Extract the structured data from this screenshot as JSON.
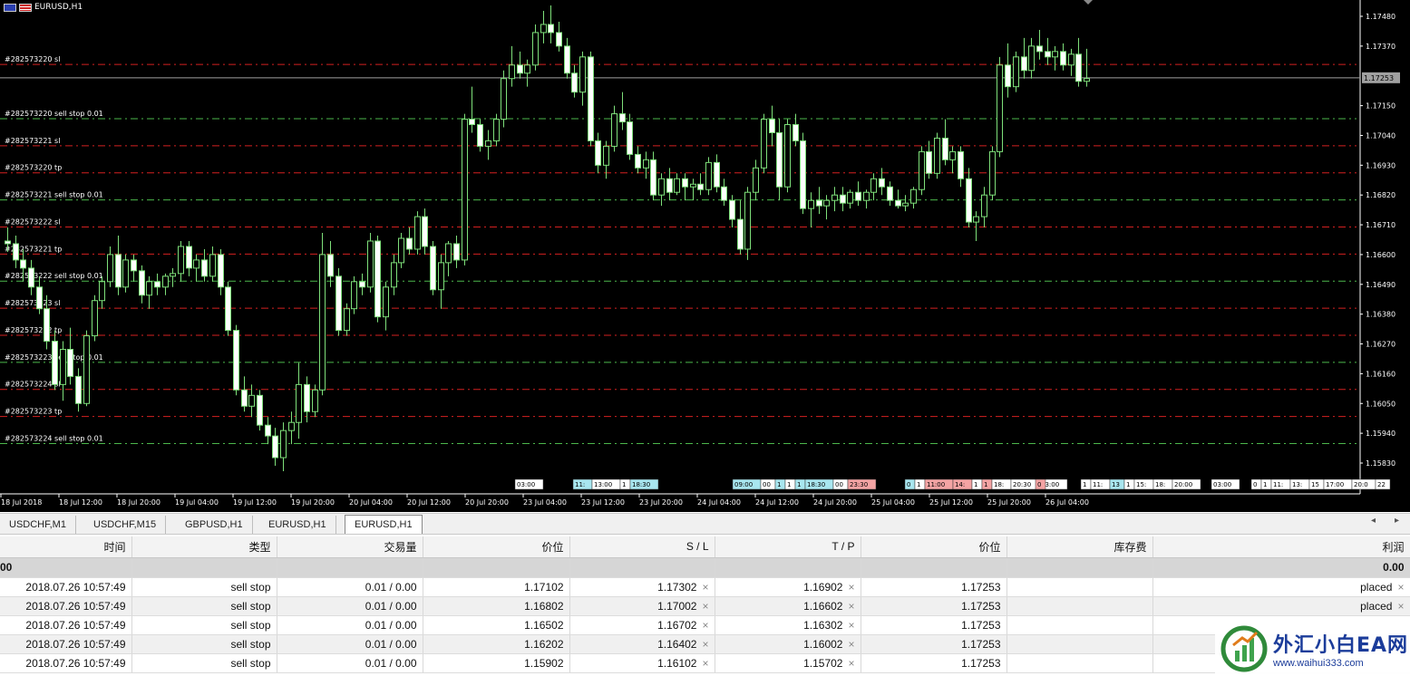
{
  "chart": {
    "symbol": "EURUSD,H1",
    "price_levels": [
      "1.17480",
      "1.17370",
      "1.17253",
      "1.17150",
      "1.17040",
      "1.16930",
      "1.16820",
      "1.16710",
      "1.16600",
      "1.16490",
      "1.16380",
      "1.16270",
      "1.16160",
      "1.16050",
      "1.15940",
      "1.15830"
    ],
    "current_price": "1.17253",
    "order_lines": [
      {
        "label": "#282573220 sl",
        "type": "sl"
      },
      {
        "label": "#282573220 sell stop 0.01",
        "type": "entry"
      },
      {
        "label": "#282573221 sl",
        "type": "sl"
      },
      {
        "label": "#282573220 tp",
        "type": "tp"
      },
      {
        "label": "#282573221 sell stop 0.01",
        "type": "entry"
      },
      {
        "label": "#282573222 sl",
        "type": "sl"
      },
      {
        "label": "#282573221 tp",
        "type": "tp"
      },
      {
        "label": "#282573222 sell stop 0.01",
        "type": "entry"
      },
      {
        "label": "#282573223 sl",
        "type": "sl"
      },
      {
        "label": "#282573222 tp",
        "type": "tp"
      },
      {
        "label": "#282573223 sell stop 0.01",
        "type": "entry"
      },
      {
        "label": "#282573224 sl",
        "type": "sl"
      },
      {
        "label": "#282573223 tp",
        "type": "tp"
      },
      {
        "label": "#282573224 sell stop 0.01",
        "type": "entry"
      }
    ],
    "time_labels": [
      "18 Jul 2018",
      "18 Jul 12:00",
      "18 Jul 20:00",
      "19 Jul 04:00",
      "19 Jul 12:00",
      "19 Jul 20:00",
      "20 Jul 04:00",
      "20 Jul 12:00",
      "20 Jul 20:00",
      "23 Jul 04:00",
      "23 Jul 12:00",
      "23 Jul 20:00",
      "24 Jul 04:00",
      "24 Jul 12:00",
      "24 Jul 20:00",
      "25 Jul 04:00",
      "25 Jul 12:00",
      "25 Jul 20:00",
      "26 Jul 04:00"
    ],
    "event_markers": [
      {
        "text": "03:00",
        "color": "#ffffff"
      },
      {
        "text": "11:",
        "color": "#a8e6ef"
      },
      {
        "text": "13:00",
        "color": "#ffffff"
      },
      {
        "text": "1",
        "color": "#ffffff"
      },
      {
        "text": "18:30",
        "color": "#a8e6ef"
      },
      {
        "text": "09:00",
        "color": "#a8e6ef"
      },
      {
        "text": "00",
        "color": "#ffffff"
      },
      {
        "text": "1",
        "color": "#a8e6ef"
      },
      {
        "text": "1",
        "color": "#ffffff"
      },
      {
        "text": "1",
        "color": "#a8e6ef"
      },
      {
        "text": "18:30",
        "color": "#a8e6ef"
      },
      {
        "text": "00",
        "color": "#ffffff"
      },
      {
        "text": "23:30",
        "color": "#f4a4a4"
      },
      {
        "text": "0",
        "color": "#a8e6ef"
      },
      {
        "text": "1",
        "color": "#ffffff"
      },
      {
        "text": "11:00",
        "color": "#f4a4a4"
      },
      {
        "text": "14:",
        "color": "#f4a4a4"
      },
      {
        "text": "1",
        "color": "#ffffff"
      },
      {
        "text": "1",
        "color": "#f4a4a4"
      },
      {
        "text": "18:",
        "color": "#ffffff"
      },
      {
        "text": "20:30",
        "color": "#ffffff"
      },
      {
        "text": "03:00",
        "color": "#ffffff"
      },
      {
        "text": "0",
        "color": "#f4a4a4"
      },
      {
        "text": "1",
        "color": "#ffffff"
      },
      {
        "text": "11:",
        "color": "#ffffff"
      },
      {
        "text": "13",
        "color": "#a8e6ef"
      },
      {
        "text": "1",
        "color": "#ffffff"
      },
      {
        "text": "15:",
        "color": "#ffffff"
      },
      {
        "text": "18:",
        "color": "#ffffff"
      },
      {
        "text": "20:00",
        "color": "#ffffff"
      },
      {
        "text": "03:00",
        "color": "#ffffff"
      },
      {
        "text": "0",
        "color": "#ffffff"
      },
      {
        "text": "1",
        "color": "#ffffff"
      },
      {
        "text": "11:",
        "color": "#ffffff"
      },
      {
        "text": "13:",
        "color": "#ffffff"
      },
      {
        "text": "15",
        "color": "#ffffff"
      },
      {
        "text": "17:00",
        "color": "#ffffff"
      },
      {
        "text": "20:0",
        "color": "#ffffff"
      },
      {
        "text": "22",
        "color": "#ffffff"
      }
    ],
    "candles": [
      [
        1.1665,
        1.167,
        1.1661,
        1.1664
      ],
      [
        1.1664,
        1.1667,
        1.1655,
        1.1658
      ],
      [
        1.1658,
        1.1662,
        1.165,
        1.1655
      ],
      [
        1.1655,
        1.1658,
        1.1645,
        1.1648
      ],
      [
        1.1648,
        1.1652,
        1.1638,
        1.164
      ],
      [
        1.164,
        1.1645,
        1.1625,
        1.1628
      ],
      [
        1.1628,
        1.1632,
        1.161,
        1.1612
      ],
      [
        1.1612,
        1.1628,
        1.1606,
        1.1625
      ],
      [
        1.1625,
        1.1633,
        1.1612,
        1.1615
      ],
      [
        1.1615,
        1.1618,
        1.1602,
        1.1605
      ],
      [
        1.1605,
        1.1632,
        1.1604,
        1.163
      ],
      [
        1.163,
        1.1645,
        1.1628,
        1.1643
      ],
      [
        1.1643,
        1.1652,
        1.164,
        1.165
      ],
      [
        1.165,
        1.1663,
        1.1648,
        1.166
      ],
      [
        1.166,
        1.1667,
        1.1645,
        1.1648
      ],
      [
        1.1648,
        1.166,
        1.1646,
        1.1658
      ],
      [
        1.1658,
        1.166,
        1.165,
        1.1654
      ],
      [
        1.1654,
        1.1656,
        1.1642,
        1.1645
      ],
      [
        1.1645,
        1.1652,
        1.164,
        1.165
      ],
      [
        1.165,
        1.1653,
        1.1645,
        1.1648
      ],
      [
        1.1648,
        1.1653,
        1.1645,
        1.1652
      ],
      [
        1.1652,
        1.1655,
        1.1648,
        1.1653
      ],
      [
        1.1653,
        1.1665,
        1.165,
        1.1663
      ],
      [
        1.1663,
        1.1665,
        1.1652,
        1.1655
      ],
      [
        1.1655,
        1.166,
        1.165,
        1.1658
      ],
      [
        1.1658,
        1.1662,
        1.165,
        1.1652
      ],
      [
        1.1652,
        1.1663,
        1.165,
        1.166
      ],
      [
        1.166,
        1.1662,
        1.1645,
        1.1648
      ],
      [
        1.1648,
        1.165,
        1.163,
        1.1632
      ],
      [
        1.1632,
        1.1634,
        1.1608,
        1.161
      ],
      [
        1.161,
        1.1615,
        1.1602,
        1.1604
      ],
      [
        1.1604,
        1.1612,
        1.16,
        1.1608
      ],
      [
        1.1608,
        1.161,
        1.1595,
        1.1597
      ],
      [
        1.1597,
        1.16,
        1.159,
        1.1593
      ],
      [
        1.1593,
        1.1596,
        1.1582,
        1.1585
      ],
      [
        1.1585,
        1.1598,
        1.158,
        1.1595
      ],
      [
        1.1595,
        1.1602,
        1.159,
        1.1598
      ],
      [
        1.1598,
        1.162,
        1.1592,
        1.1612
      ],
      [
        1.1612,
        1.1615,
        1.1598,
        1.1602
      ],
      [
        1.1602,
        1.1612,
        1.16,
        1.161
      ],
      [
        1.161,
        1.1668,
        1.1608,
        1.166
      ],
      [
        1.166,
        1.1665,
        1.1648,
        1.1652
      ],
      [
        1.1652,
        1.1655,
        1.163,
        1.1632
      ],
      [
        1.1632,
        1.1642,
        1.163,
        1.164
      ],
      [
        1.164,
        1.1652,
        1.1638,
        1.165
      ],
      [
        1.165,
        1.1653,
        1.1645,
        1.1648
      ],
      [
        1.1648,
        1.1668,
        1.1646,
        1.1665
      ],
      [
        1.1665,
        1.1667,
        1.1635,
        1.1637
      ],
      [
        1.1637,
        1.165,
        1.1632,
        1.1648
      ],
      [
        1.1648,
        1.166,
        1.1645,
        1.1657
      ],
      [
        1.1657,
        1.1668,
        1.1655,
        1.1666
      ],
      [
        1.1666,
        1.167,
        1.166,
        1.1662
      ],
      [
        1.1662,
        1.1676,
        1.166,
        1.1674
      ],
      [
        1.1674,
        1.1677,
        1.166,
        1.1663
      ],
      [
        1.1663,
        1.1665,
        1.1645,
        1.1647
      ],
      [
        1.1647,
        1.166,
        1.164,
        1.1657
      ],
      [
        1.1657,
        1.1665,
        1.1652,
        1.1664
      ],
      [
        1.1664,
        1.1667,
        1.1655,
        1.1658
      ],
      [
        1.1658,
        1.1712,
        1.1656,
        1.171
      ],
      [
        1.171,
        1.1722,
        1.1705,
        1.1708
      ],
      [
        1.1708,
        1.171,
        1.1698,
        1.17
      ],
      [
        1.17,
        1.1706,
        1.1695,
        1.1702
      ],
      [
        1.1702,
        1.1712,
        1.17,
        1.171
      ],
      [
        1.171,
        1.1728,
        1.1707,
        1.1725
      ],
      [
        1.1725,
        1.1737,
        1.1722,
        1.173
      ],
      [
        1.173,
        1.1735,
        1.1725,
        1.1727
      ],
      [
        1.1727,
        1.1732,
        1.1722,
        1.173
      ],
      [
        1.173,
        1.1745,
        1.1728,
        1.1742
      ],
      [
        1.1742,
        1.175,
        1.1738,
        1.1745
      ],
      [
        1.1745,
        1.1752,
        1.1738,
        1.1742
      ],
      [
        1.1742,
        1.1746,
        1.1735,
        1.1737
      ],
      [
        1.1737,
        1.174,
        1.1725,
        1.1727
      ],
      [
        1.1727,
        1.173,
        1.1718,
        1.172
      ],
      [
        1.172,
        1.1735,
        1.1715,
        1.1733
      ],
      [
        1.1733,
        1.1735,
        1.17,
        1.1702
      ],
      [
        1.1702,
        1.1705,
        1.169,
        1.1693
      ],
      [
        1.1693,
        1.1702,
        1.1688,
        1.17
      ],
      [
        1.17,
        1.1715,
        1.1698,
        1.1712
      ],
      [
        1.1712,
        1.172,
        1.1706,
        1.1709
      ],
      [
        1.1709,
        1.1712,
        1.1695,
        1.1697
      ],
      [
        1.1697,
        1.17,
        1.169,
        1.1692
      ],
      [
        1.1692,
        1.1698,
        1.1688,
        1.1695
      ],
      [
        1.1695,
        1.1698,
        1.168,
        1.1682
      ],
      [
        1.1682,
        1.169,
        1.1678,
        1.1688
      ],
      [
        1.1688,
        1.1692,
        1.168,
        1.1683
      ],
      [
        1.1683,
        1.169,
        1.1682,
        1.1688
      ],
      [
        1.1688,
        1.169,
        1.168,
        1.1685
      ],
      [
        1.1685,
        1.1688,
        1.168,
        1.1686
      ],
      [
        1.1686,
        1.169,
        1.1682,
        1.1684
      ],
      [
        1.1684,
        1.1696,
        1.1682,
        1.1694
      ],
      [
        1.1694,
        1.1697,
        1.1683,
        1.1685
      ],
      [
        1.1685,
        1.1688,
        1.1678,
        1.168
      ],
      [
        1.168,
        1.1682,
        1.167,
        1.1673
      ],
      [
        1.1673,
        1.168,
        1.166,
        1.1662
      ],
      [
        1.1662,
        1.1685,
        1.1658,
        1.1683
      ],
      [
        1.1683,
        1.1695,
        1.168,
        1.1692
      ],
      [
        1.1692,
        1.1712,
        1.169,
        1.171
      ],
      [
        1.171,
        1.1715,
        1.17,
        1.1705
      ],
      [
        1.1705,
        1.171,
        1.168,
        1.1685
      ],
      [
        1.1685,
        1.171,
        1.1683,
        1.1708
      ],
      [
        1.1708,
        1.1712,
        1.17,
        1.1702
      ],
      [
        1.1702,
        1.1705,
        1.1675,
        1.1677
      ],
      [
        1.1677,
        1.1683,
        1.167,
        1.168
      ],
      [
        1.168,
        1.1685,
        1.1675,
        1.1678
      ],
      [
        1.1678,
        1.1682,
        1.1673,
        1.168
      ],
      [
        1.168,
        1.1685,
        1.1676,
        1.1682
      ],
      [
        1.1682,
        1.1685,
        1.1676,
        1.1679
      ],
      [
        1.1679,
        1.1684,
        1.1677,
        1.1683
      ],
      [
        1.1683,
        1.1687,
        1.1678,
        1.168
      ],
      [
        1.168,
        1.1684,
        1.1677,
        1.1683
      ],
      [
        1.1683,
        1.169,
        1.168,
        1.1688
      ],
      [
        1.1688,
        1.1692,
        1.1682,
        1.1685
      ],
      [
        1.1685,
        1.1687,
        1.1678,
        1.168
      ],
      [
        1.168,
        1.1684,
        1.1677,
        1.1678
      ],
      [
        1.1678,
        1.1682,
        1.1676,
        1.1679
      ],
      [
        1.1679,
        1.1685,
        1.1677,
        1.1684
      ],
      [
        1.1684,
        1.17,
        1.1682,
        1.1698
      ],
      [
        1.1698,
        1.1702,
        1.1688,
        1.169
      ],
      [
        1.169,
        1.1705,
        1.1688,
        1.1703
      ],
      [
        1.1703,
        1.171,
        1.1693,
        1.1695
      ],
      [
        1.1695,
        1.17,
        1.169,
        1.1698
      ],
      [
        1.1698,
        1.17,
        1.1685,
        1.1688
      ],
      [
        1.1688,
        1.1692,
        1.167,
        1.1672
      ],
      [
        1.1672,
        1.1676,
        1.1665,
        1.1674
      ],
      [
        1.1674,
        1.1685,
        1.167,
        1.1682
      ],
      [
        1.1682,
        1.17,
        1.168,
        1.1698
      ],
      [
        1.1698,
        1.1733,
        1.1696,
        1.173
      ],
      [
        1.173,
        1.1738,
        1.1718,
        1.1722
      ],
      [
        1.1722,
        1.1735,
        1.172,
        1.1733
      ],
      [
        1.1733,
        1.174,
        1.1725,
        1.1728
      ],
      [
        1.1728,
        1.174,
        1.1725,
        1.1737
      ],
      [
        1.1737,
        1.1743,
        1.1732,
        1.1735
      ],
      [
        1.1735,
        1.174,
        1.173,
        1.1733
      ],
      [
        1.1733,
        1.1737,
        1.1728,
        1.1735
      ],
      [
        1.1735,
        1.1738,
        1.1728,
        1.173
      ],
      [
        1.173,
        1.1736,
        1.1726,
        1.1734
      ],
      [
        1.1734,
        1.174,
        1.1722,
        1.1724
      ],
      [
        1.1724,
        1.1736,
        1.1722,
        1.1725
      ]
    ]
  },
  "tabs": [
    "USDCHF,M1",
    "USDCHF,M15",
    "GBPUSD,H1",
    "EURUSD,H1",
    "EURUSD,H1"
  ],
  "active_tab_index": 4,
  "table": {
    "headers": [
      "时间",
      "类型",
      "交易量",
      "价位",
      "S / L",
      "T / P",
      "价位",
      "库存费",
      "利润"
    ],
    "summary": {
      "first": "00",
      "profit": "0.00"
    },
    "rows": [
      {
        "time": "2018.07.26 10:57:49",
        "type": "sell stop",
        "volume": "0.01 / 0.00",
        "price": "1.17102",
        "sl": "1.17302",
        "tp": "1.16902",
        "current": "1.17253",
        "swap": "",
        "profit": "placed"
      },
      {
        "time": "2018.07.26 10:57:49",
        "type": "sell stop",
        "volume": "0.01 / 0.00",
        "price": "1.16802",
        "sl": "1.17002",
        "tp": "1.16602",
        "current": "1.17253",
        "swap": "",
        "profit": "placed"
      },
      {
        "time": "2018.07.26 10:57:49",
        "type": "sell stop",
        "volume": "0.01 / 0.00",
        "price": "1.16502",
        "sl": "1.16702",
        "tp": "1.16302",
        "current": "1.17253",
        "swap": "",
        "profit": ""
      },
      {
        "time": "2018.07.26 10:57:49",
        "type": "sell stop",
        "volume": "0.01 / 0.00",
        "price": "1.16202",
        "sl": "1.16402",
        "tp": "1.16002",
        "current": "1.17253",
        "swap": "",
        "profit": ""
      },
      {
        "time": "2018.07.26 10:57:49",
        "type": "sell stop",
        "volume": "0.01 / 0.00",
        "price": "1.15902",
        "sl": "1.16102",
        "tp": "1.15702",
        "current": "1.17253",
        "swap": "",
        "profit": ""
      }
    ]
  },
  "watermark": {
    "title": "外汇小白EA网",
    "url": "www.waihui333.com"
  },
  "colors": {
    "candle": "#7ee07a",
    "sl_line": "#d42020",
    "tp_line": "#d42020",
    "entry_line": "#4cb84c",
    "price_line": "#a0a0a0"
  }
}
